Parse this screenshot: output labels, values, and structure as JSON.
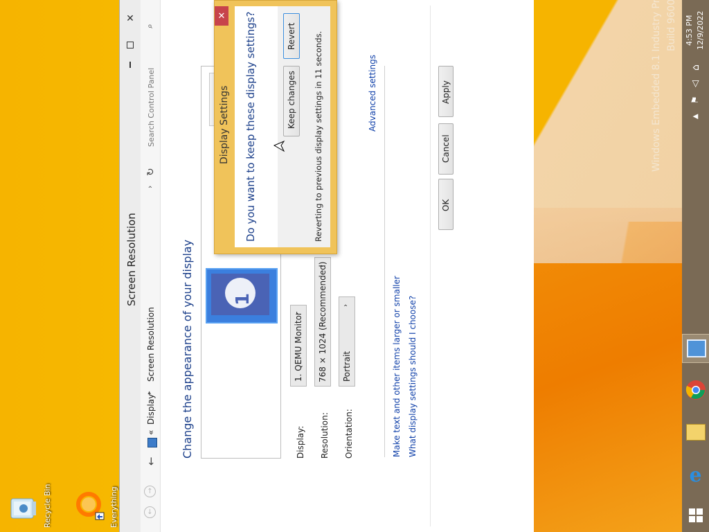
{
  "desktop": {
    "recycle_bin": "Recycle Bin",
    "everything": "Everything",
    "watermark_line1": "Windows Embedded 8.1 Industry Pro",
    "watermark_line2": "Build 9600"
  },
  "window": {
    "title": "Screen Resolution",
    "breadcrumb": {
      "prefix": "«",
      "item1": "Display",
      "sep": "▸",
      "item2": "Screen Resolution"
    },
    "search_placeholder": "Search Control Panel",
    "heading": "Change the appearance of your display",
    "monitor_number": "1",
    "fields": {
      "display_label": "Display:",
      "display_value": "1. QEMU Monitor",
      "resolution_label": "Resolution:",
      "resolution_value": "768 × 1024 (Recommended)",
      "orientation_label": "Orientation:",
      "orientation_value": "Portrait"
    },
    "advanced_settings": "Advanced settings",
    "link_text_size": "Make text and other items larger or smaller",
    "link_what_settings": "What display settings should I choose?",
    "buttons": {
      "ok": "OK",
      "cancel": "Cancel",
      "apply": "Apply"
    }
  },
  "dialog": {
    "title": "Display Settings",
    "question": "Do you want to keep these display settings?",
    "countdown": "Reverting to previous display settings in 11 seconds.",
    "keep_label": "Keep changes",
    "revert_label": "Revert",
    "close_glyph": "✕"
  },
  "taskbar": {
    "time": "4:53 PM",
    "date": "12/9/2022"
  },
  "colors": {
    "desktop": "#f6b400",
    "dialog_frame": "#f0c35a",
    "link": "#0d3ea8",
    "taskbar": "#7a6a55",
    "close_button": "#c7434b"
  }
}
